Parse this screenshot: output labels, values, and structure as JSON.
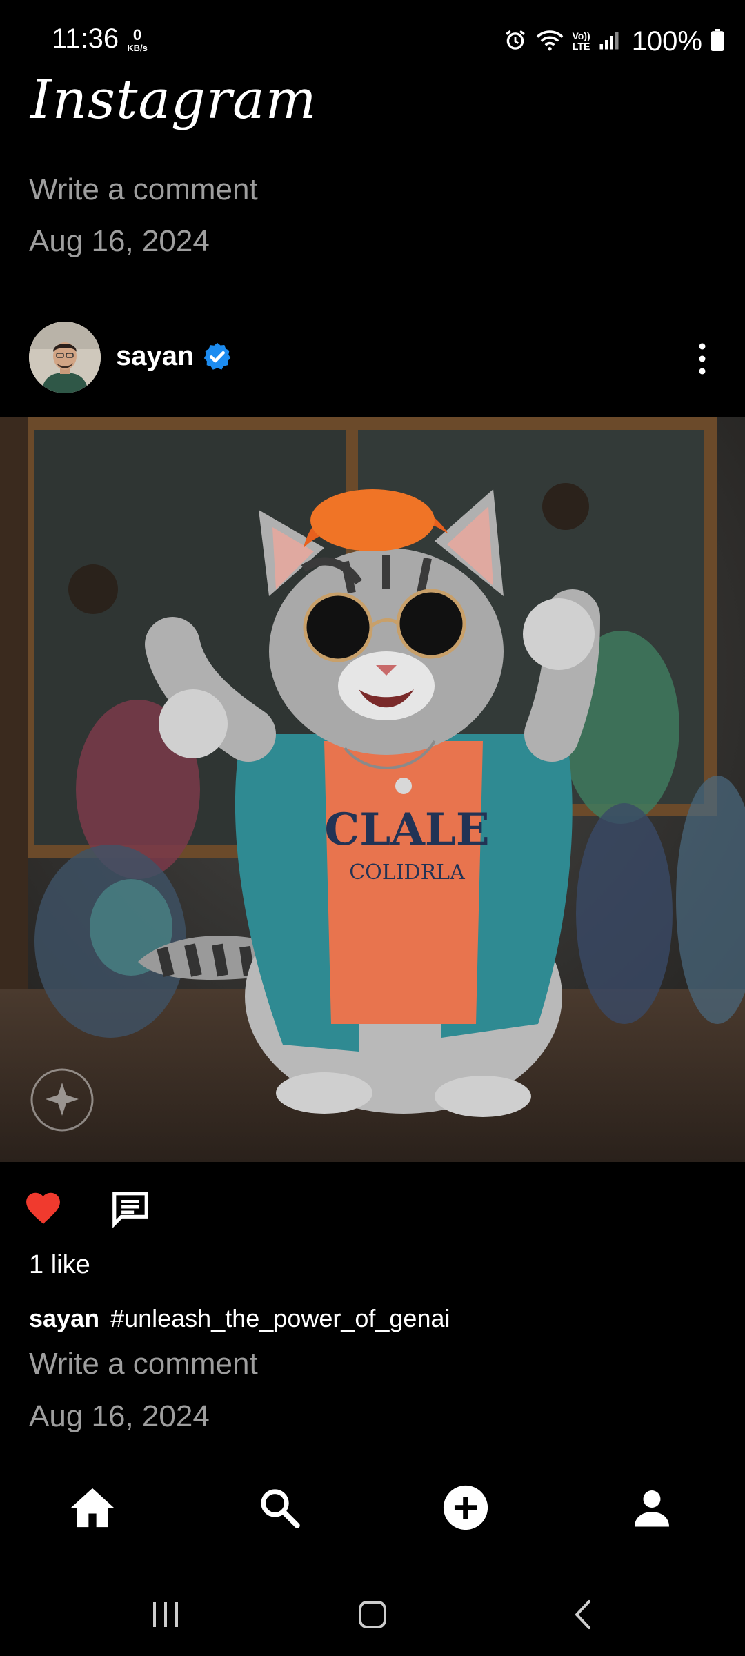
{
  "status_bar": {
    "time": "11:36",
    "net_speed_value": "0",
    "net_speed_unit": "KB/s",
    "network_label_top": "Vo))",
    "network_label_bottom": "LTE",
    "battery": "100%"
  },
  "header": {
    "logo": "Instagram"
  },
  "previous_post": {
    "comment_placeholder": "Write a comment",
    "date": "Aug 16, 2024"
  },
  "post": {
    "username": "sayan",
    "verified": true,
    "image_icon": "cat-with-sunglasses-image",
    "watermark_icon": "ai-imagined-watermark",
    "liked": true,
    "likes_text": "1 like",
    "caption_user": "sayan",
    "caption_text": "#unleash_the_power_of_genai",
    "comment_placeholder": "Write a comment",
    "date": "Aug 16, 2024"
  },
  "bottom_nav": {
    "items": [
      {
        "icon": "home-icon",
        "active": true
      },
      {
        "icon": "search-icon",
        "active": false
      },
      {
        "icon": "add-post-icon",
        "active": false
      },
      {
        "icon": "profile-icon",
        "active": false
      }
    ]
  },
  "system_nav": {
    "items": [
      "recent-apps-icon",
      "home-button-icon",
      "back-icon"
    ]
  },
  "colors": {
    "background": "#000000",
    "secondary_text": "#9e9e9e",
    "like_red": "#f03a2e",
    "verified_blue": "#1d8cf0"
  }
}
